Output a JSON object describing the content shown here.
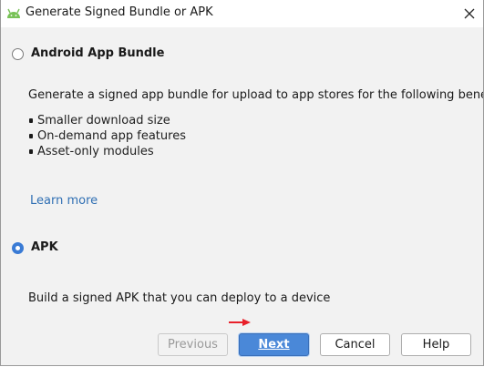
{
  "window": {
    "title": "Generate Signed Bundle or APK",
    "close_glyph": "✕"
  },
  "options": [
    {
      "label": "Android App Bundle",
      "selected": false,
      "description": "Generate a signed app bundle for upload to app stores for the following benefits:",
      "benefits": [
        "Smaller download size",
        "On-demand app features",
        "Asset-only modules"
      ],
      "link": "Learn more"
    },
    {
      "label": "APK",
      "selected": true,
      "description": "Build a signed APK that you can deploy to a device"
    }
  ],
  "buttons": {
    "previous": "Previous",
    "next": "Next",
    "cancel": "Cancel",
    "help": "Help"
  },
  "colors": {
    "accent": "#4a88d8",
    "link": "#2f6fb3",
    "annotation_arrow": "#e8202a",
    "android_green": "#78c257"
  },
  "icons": [
    "android-icon",
    "close-icon",
    "red-arrow-annotation"
  ]
}
